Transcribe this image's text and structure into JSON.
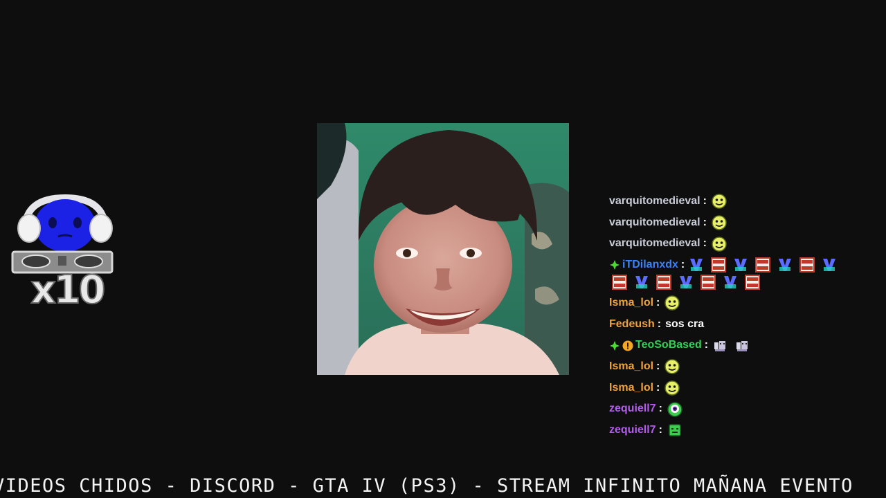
{
  "overlay": {
    "mascot_multiplier": "x10"
  },
  "colors": {
    "background": "#0e0e0e",
    "user_gray": "#c9cdd8",
    "user_orange": "#f0a23c",
    "user_blue": "#3b82f6",
    "user_green": "#34d058",
    "user_purple": "#b45cf0",
    "badge_green": "#4ade30",
    "badge_gold": "#f5a623"
  },
  "chat": {
    "messages": [
      {
        "user": "varquitomedieval",
        "sep": ":",
        "emote": "yellow-smiley-emote"
      },
      {
        "user": "varquitomedieval",
        "sep": ":",
        "emote": "yellow-smiley-emote"
      },
      {
        "user": "varquitomedieval",
        "sep": ":",
        "emote": "yellow-smiley-emote"
      },
      {
        "user": "iTDilanxdx",
        "sep": ":",
        "badges": [
          "plus-badge"
        ],
        "emotes": [
          "videos-chidos-emote"
        ]
      },
      {
        "user": "Isma_lol",
        "sep": ":",
        "emote": "yellow-smiley-emote"
      },
      {
        "user": "Fedeush",
        "sep": ":",
        "text": "sos cra"
      },
      {
        "user": "TeoSoBased",
        "sep": ":",
        "badges": [
          "plus-badge",
          "warning-badge"
        ],
        "emotes": [
          "pixel-cat-emote",
          "pixel-cat-emote"
        ]
      },
      {
        "user": "Isma_lol",
        "sep": ":",
        "emote": "yellow-smiley-emote"
      },
      {
        "user": "Isma_lol",
        "sep": ":",
        "emote": "yellow-smiley-emote"
      },
      {
        "user": "zequiell7",
        "sep": ":",
        "emote": "cyclops-emote"
      },
      {
        "user": "zequiell7",
        "sep": ":",
        "emote": "green-face-emote"
      }
    ]
  },
  "ticker": {
    "text": "VIDEOS CHIDOS - DISCORD - GTA IV (PS3) - STREAM INFINITO MAÑANA EVENTO"
  }
}
